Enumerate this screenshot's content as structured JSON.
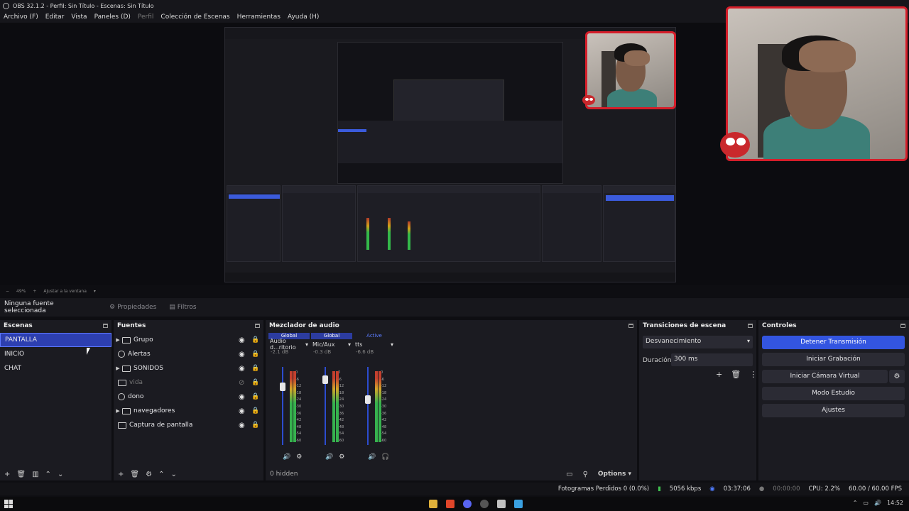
{
  "window": {
    "title": "OBS 32.1.2 - Perfil: Sin Título - Escenas: Sin Título"
  },
  "menu": [
    "Archivo (F)",
    "Editar",
    "Vista",
    "Paneles (D)",
    "Perfil",
    "Colección de Escenas",
    "Herramientas",
    "Ayuda (H)"
  ],
  "zoom": {
    "percent": "49%",
    "fit": "Ajustar a la ventana"
  },
  "source_bar": {
    "none_selected": "Ninguna fuente seleccionada",
    "properties": "Propiedades",
    "filters": "Filtros"
  },
  "scenes": {
    "title": "Escenas",
    "items": [
      "PANTALLA",
      "INICIO",
      "CHAT"
    ],
    "selected": "PANTALLA"
  },
  "sources": {
    "title": "Fuentes",
    "items": [
      {
        "label": "Grupo",
        "group": true,
        "dim": false
      },
      {
        "label": "Alertas",
        "group": false,
        "dim": false
      },
      {
        "label": "SONIDOS",
        "group": true,
        "dim": false
      },
      {
        "label": "vida",
        "group": false,
        "dim": true
      },
      {
        "label": "dono",
        "group": false,
        "dim": false
      },
      {
        "label": "navegadores",
        "group": true,
        "dim": false
      },
      {
        "label": "Captura de pantalla",
        "group": false,
        "dim": false
      }
    ]
  },
  "mixer": {
    "title": "Mezclador de audio",
    "channels": [
      {
        "tag": "Global",
        "name": "Audio d...ritorio",
        "db": "-2.1 dB"
      },
      {
        "tag": "Global",
        "name": "Mic/Aux",
        "db": "-0.3 dB"
      },
      {
        "tag": "Active",
        "name": "tts",
        "db": "-6.6 dB"
      }
    ],
    "ticks": [
      "0",
      "-6",
      "-12",
      "-18",
      "-24",
      "-30",
      "-36",
      "-42",
      "-48",
      "-54",
      "-60"
    ],
    "hidden": "0 hidden",
    "options": "Options"
  },
  "transitions": {
    "title": "Transiciones de escena",
    "type": "Desvanecimiento",
    "duration_label": "Duración",
    "duration": "300 ms"
  },
  "controls": {
    "title": "Controles",
    "stop_stream": "Detener Transmisión",
    "start_record": "Iniciar Grabación",
    "virtual_cam": "Iniciar Cámara Virtual",
    "studio": "Modo Estudio",
    "settings": "Ajustes"
  },
  "status": {
    "dropped": "Fotogramas Perdidos 0 (0.0%)",
    "kbps": "5056 kbps",
    "stream_time": "03:37:06",
    "rec_time": "00:00:00",
    "cpu": "CPU: 2.2%",
    "fps": "60.00 / 60.00 FPS"
  },
  "clock": "14:52",
  "colors": {
    "accent": "#3355e0",
    "webcam_border": "#d51e2a",
    "meter_green": "#36b24e"
  }
}
